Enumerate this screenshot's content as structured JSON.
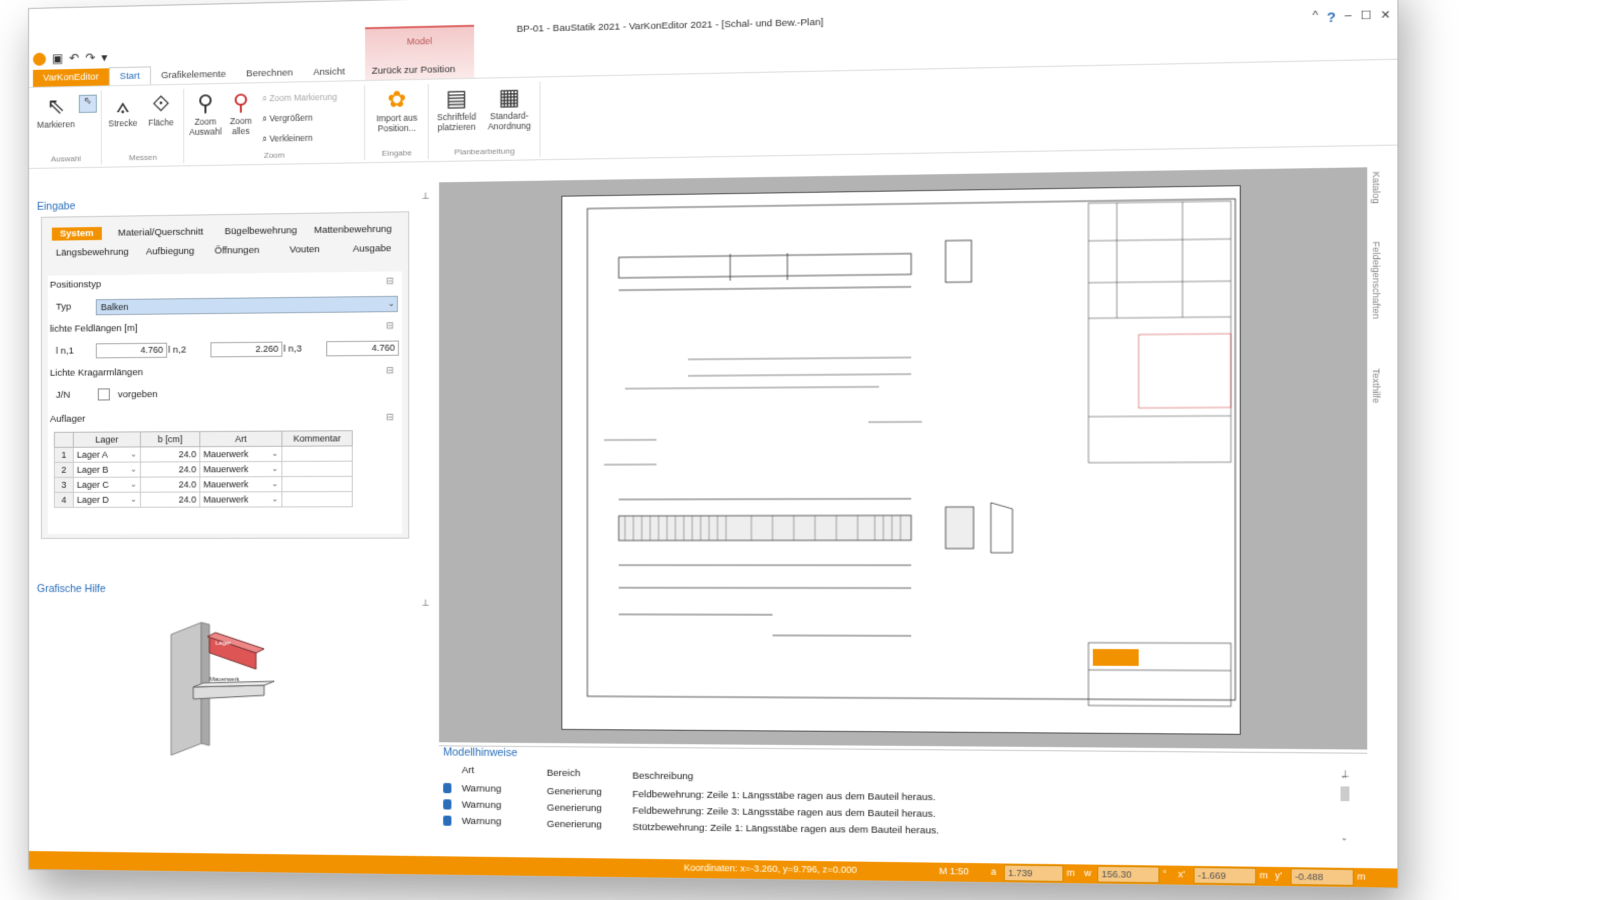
{
  "window": {
    "title": "BP-01 - BauStatik 2021 - VarKonEditor 2021 - [Schal- und Bew.-Plan]",
    "controls": [
      "–",
      "☐",
      "✕"
    ],
    "controls2": [
      "^",
      "?",
      "–",
      "☐",
      "✕"
    ]
  },
  "quick_access": [
    "▣",
    "↶",
    "↷",
    "▾"
  ],
  "context_tab": {
    "group_label": "Model",
    "tab_label": "Zurück zur Position"
  },
  "tabs": {
    "file": "VarKonEditor",
    "items": [
      "Start",
      "Grafikelemente",
      "Berechnen",
      "Ansicht"
    ]
  },
  "ribbon": {
    "auswahl": {
      "label": "Auswahl",
      "markieren": "Markieren"
    },
    "messen": {
      "label": "Messen",
      "strecke": "Strecke",
      "flaeche": "Fläche"
    },
    "zoom": {
      "label": "Zoom",
      "zoom_auswahl": "Zoom Auswahl",
      "zoom_alles": "Zoom alles",
      "zoom_markierung": "Zoom Markierung",
      "vergroessern": "Vergrößern",
      "verkleinern": "Verkleinern"
    },
    "eingabe": {
      "label": "Eingabe",
      "import": "Import aus Position..."
    },
    "planbearbeitung": {
      "label": "Planbearbeitung",
      "schriftfeld": "Schriftfeld platzieren",
      "standard": "Standard-Anordnung"
    }
  },
  "eingabe_panel": {
    "title": "Eingabe",
    "pin": "⊥",
    "nav_tabs": [
      "System",
      "Material/Querschnitt",
      "Bügelbewehrung",
      "Mattenbewehrung",
      "Längsbewehrung",
      "Aufbiegung",
      "Öffnungen",
      "Vouten",
      "Ausgabe"
    ],
    "positionstyp": {
      "header": "Positionstyp",
      "typ_label": "Typ",
      "typ_value": "Balken"
    },
    "feldlaengen": {
      "header": "lichte Feldlängen [m]",
      "labels": [
        "l n,1",
        "l n,2",
        "l n,3"
      ],
      "values": [
        "4.760",
        "2.260",
        "4.760"
      ]
    },
    "kragarm": {
      "header": "Lichte Kragarmlängen",
      "label": "J/N",
      "check_label": "vorgeben"
    },
    "auflager": {
      "header": "Auflager",
      "columns": [
        "Lager",
        "b [cm]",
        "Art",
        "Kommentar"
      ],
      "rows": [
        {
          "nr": "1",
          "lager": "Lager A",
          "b": "24.0",
          "art": "Mauerwerk",
          "kommentar": ""
        },
        {
          "nr": "2",
          "lager": "Lager B",
          "b": "24.0",
          "art": "Mauerwerk",
          "kommentar": ""
        },
        {
          "nr": "3",
          "lager": "Lager C",
          "b": "24.0",
          "art": "Mauerwerk",
          "kommentar": ""
        },
        {
          "nr": "4",
          "lager": "Lager D",
          "b": "24.0",
          "art": "Mauerwerk",
          "kommentar": ""
        }
      ]
    }
  },
  "grafische_hilfe": {
    "title": "Grafische Hilfe",
    "label1": "Lager",
    "label2": "Mauerwerk"
  },
  "right_strip": [
    "Katalog",
    "Feldeigenschaften",
    "Texthilfe"
  ],
  "modellhinweise": {
    "title": "Modellhinweise",
    "columns": [
      "Art",
      "Bereich",
      "Beschreibung"
    ],
    "rows": [
      {
        "art": "Warnung",
        "bereich": "Generierung",
        "beschreibung": "Feldbewehrung: Zeile 1: Längsstäbe ragen aus dem Bauteil heraus."
      },
      {
        "art": "Warnung",
        "bereich": "Generierung",
        "beschreibung": "Feldbewehrung: Zeile 3: Längsstäbe ragen aus dem Bauteil heraus."
      },
      {
        "art": "Warnung",
        "bereich": "Generierung",
        "beschreibung": "Stützbewehrung: Zeile 1: Längsstäbe ragen aus dem Bauteil heraus."
      }
    ]
  },
  "statusbar": {
    "coords": "Koordinaten: x=-3.260, y=9.796, z=0.000",
    "scale": "M 1:50",
    "fields": [
      {
        "label": "a",
        "value": "1.739",
        "unit": "m"
      },
      {
        "label": "w",
        "value": "156.30",
        "unit": "°"
      },
      {
        "label": "x'",
        "value": "-1.669",
        "unit": "m"
      },
      {
        "label": "y'",
        "value": "-0.488",
        "unit": "m"
      }
    ]
  },
  "colors": {
    "accent": "#f39200",
    "link": "#2a6ebb",
    "context": "#f3c9c9",
    "canvas_bg": "#b3b3b3"
  }
}
